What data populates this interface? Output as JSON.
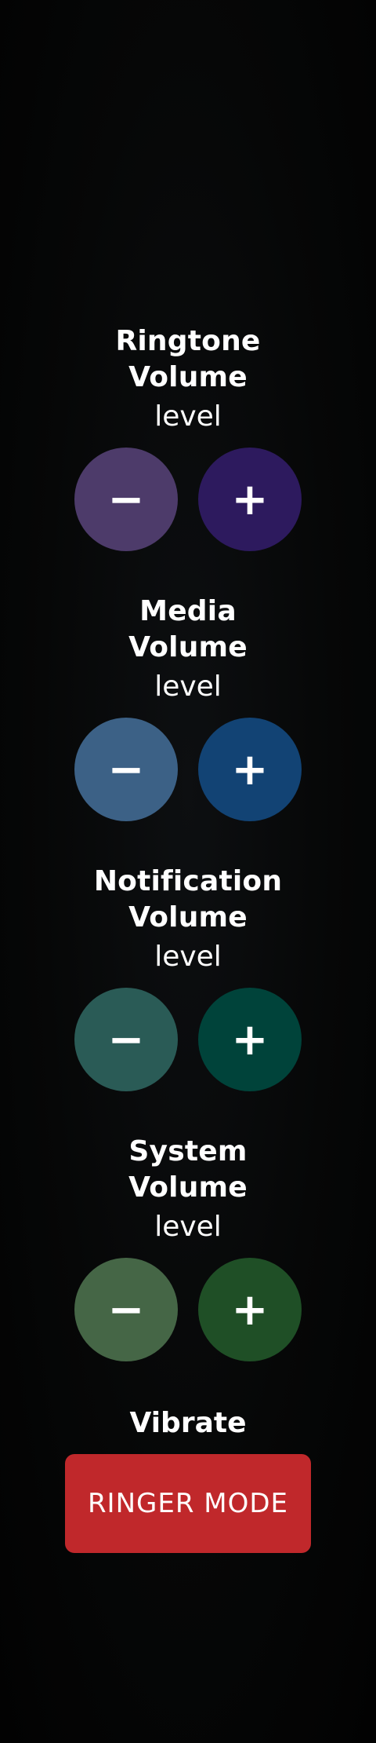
{
  "volumes": [
    {
      "title": "Ringtone Volume",
      "level_label": "level",
      "minus_label": "−",
      "plus_label": "+",
      "minus_color": "#4d3b6a",
      "plus_color": "#2d1a5e"
    },
    {
      "title": "Media Volume",
      "level_label": "level",
      "minus_label": "−",
      "plus_label": "+",
      "minus_color": "#3c6186",
      "plus_color": "#124374"
    },
    {
      "title": "Notification Volume",
      "level_label": "level",
      "minus_label": "−",
      "plus_label": "+",
      "minus_color": "#2a5b56",
      "plus_color": "#00433a"
    },
    {
      "title": "System Volume",
      "level_label": "level",
      "minus_label": "−",
      "plus_label": "+",
      "minus_color": "#456646",
      "plus_color": "#1f4f26"
    }
  ],
  "vibrate": {
    "title": "Vibrate",
    "button_label": "RINGER MODE",
    "button_color": "#c0282b"
  }
}
